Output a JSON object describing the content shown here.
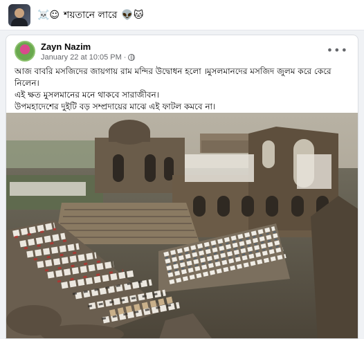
{
  "group": {
    "title_prefix": "☠️☺",
    "title": "শয়তানে লারে",
    "title_suffix": "👽🐱"
  },
  "post": {
    "author": "Zayn Nazim",
    "time": "January 22 at 10:05 PM",
    "time_separator": "·",
    "more_label": "•••",
    "text_lines": [
      "আজ বাবরি মসজিদের জায়গায় রাম মন্দির উদ্বোধন হলো ।মুসলমানদের মসজিদ জুলম করে কেরে নিলেন।",
      "এই ক্ষত মুসলমানের মনে থাকবে সারাজীবন।",
      "উপমহাদেশের দুইটি বড় সম্প্রদায়ের মাঝে এই ফাটল কমবে না।"
    ]
  },
  "colors": {
    "text_primary": "#050505",
    "text_secondary": "#65676b",
    "background": "#f0f2f5"
  },
  "icons": {
    "more": "more-options-icon",
    "privacy": "globe-icon"
  }
}
